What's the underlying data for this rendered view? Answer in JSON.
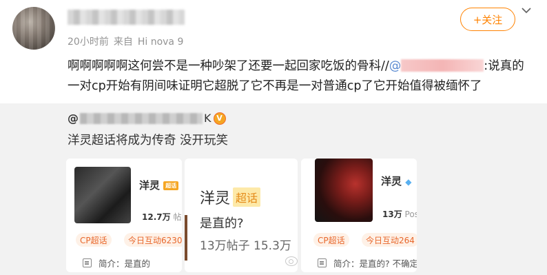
{
  "post": {
    "time": "20小时前",
    "source_prefix": "来自",
    "source_device": "Hi nova 9",
    "follow_label": "+关注",
    "text_prefix": "啊啊啊啊啊这何尝不是一种吵架了还要一起回家吃饭的骨科//",
    "mention_at": "@",
    "text_suffix": ":说真的一对cp开始有阴间味证明它超脱了它不再是一对普通cp了它开始值得被缅怀了"
  },
  "repost": {
    "user_at": "@",
    "user_tail": "K",
    "verified_badge": "V",
    "text": "洋灵超话将成为传奇 没开玩笑"
  },
  "cards": [
    {
      "title": "洋灵",
      "mini_tag": "超话",
      "stat_value": "12.7万",
      "stat_label": "帖",
      "chip1": "CP超话",
      "chip2": "今日互动6230",
      "desc": "简介：是直的"
    },
    {
      "title": "洋灵",
      "tag": "超话",
      "subtitle": "是直的?",
      "stats": "13万帖子 15.3万"
    },
    {
      "title": "洋灵",
      "stat_value": "13万",
      "stat_label": "Pos",
      "chip1": "CP超话",
      "chip2": "今日互动264",
      "desc": "简介：是直的? 不确定"
    }
  ]
}
